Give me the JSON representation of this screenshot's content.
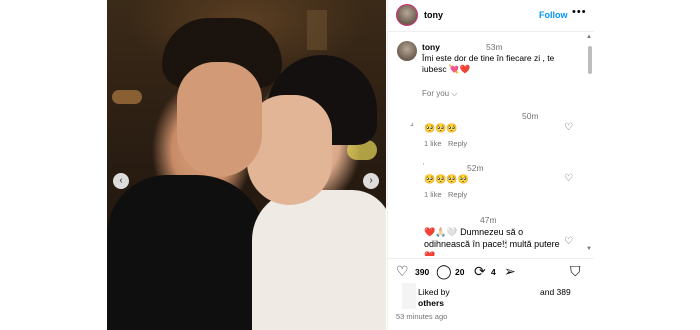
{
  "header": {
    "username": "tony",
    "follow_label": "Follow",
    "more_icon": "•••"
  },
  "caption": {
    "username": "tony",
    "time": "53m",
    "text": "Îmi este dor de tine în fiecare zi , te iubesc 💘❤️"
  },
  "for_you_label": "For you ⌵",
  "comments": [
    {
      "time": "50m",
      "text": "🥺🥺🥺",
      "likes": "1 like",
      "reply": "Reply"
    },
    {
      "time": "52m",
      "text": "🥺🥺🥺🥺",
      "likes": "1 like",
      "reply": "Reply"
    },
    {
      "time": "47m",
      "text": "❤️🙏🏻🤍 Dumnezeu să o odihnească în pace!🕯 multă putere ❤️"
    }
  ],
  "actions": {
    "likes_count": "390",
    "comments_count": "20",
    "shares_count": "4"
  },
  "liked_by": {
    "prefix": "Liked by",
    "others": "others",
    "and_count": "and 389"
  },
  "posted_ago": "53 minutes ago",
  "nav": {
    "prev": "‹",
    "next": "›"
  },
  "colors": {
    "follow": "#0095f6",
    "story_ring": "#d62976"
  }
}
